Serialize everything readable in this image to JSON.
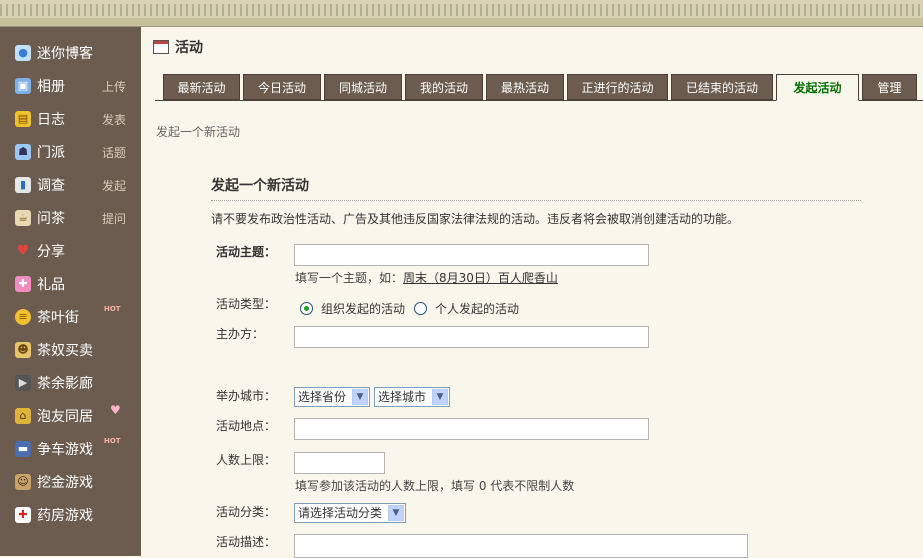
{
  "sidebar": {
    "items": [
      {
        "label": "迷你博客",
        "sub": "",
        "icon": "speech-bubble-icon"
      },
      {
        "label": "相册",
        "sub": "上传",
        "icon": "photo-icon"
      },
      {
        "label": "日志",
        "sub": "发表",
        "icon": "notebook-icon"
      },
      {
        "label": "门派",
        "sub": "话题",
        "icon": "group-icon"
      },
      {
        "label": "调查",
        "sub": "发起",
        "icon": "bar-chart-icon"
      },
      {
        "label": "问茶",
        "sub": "提问",
        "icon": "tea-cup-icon"
      },
      {
        "label": "分享",
        "sub": "",
        "icon": "heart-share-icon"
      },
      {
        "label": "礼品",
        "sub": "",
        "icon": "gift-icon"
      },
      {
        "label": "茶叶街",
        "sub": "",
        "icon": "coins-icon",
        "badge": "HOT"
      },
      {
        "label": "茶奴买卖",
        "sub": "",
        "icon": "trade-icon"
      },
      {
        "label": "茶余影廊",
        "sub": "",
        "icon": "film-icon"
      },
      {
        "label": "泡友同居",
        "sub": "",
        "icon": "house-icon",
        "heart": "♥"
      },
      {
        "label": "争车游戏",
        "sub": "",
        "icon": "car-icon",
        "badge": "HOT"
      },
      {
        "label": "挖金游戏",
        "sub": "",
        "icon": "miner-icon"
      },
      {
        "label": "药房游戏",
        "sub": "",
        "icon": "medicine-icon"
      }
    ]
  },
  "page": {
    "title": "活动"
  },
  "tabs": [
    "最新活动",
    "今日活动",
    "同城活动",
    "我的活动",
    "最热活动",
    "正进行的活动",
    "已结束的活动",
    "发起活动",
    "管理"
  ],
  "active_tab": "发起活动",
  "breadcrumb": "发起一个新活动",
  "form": {
    "title": "发起一个新活动",
    "notice": "请不要发布政治性活动、广告及其他违反国家法律法规的活动。违反者将会被取消创建活动的功能。",
    "subject_label": "活动主题：",
    "subject_hint_prefix": "填写一个主题，如：",
    "subject_hint_example": "周末（8月30日）百人爬香山",
    "type_label": "活动类型：",
    "type_option_org": "组织发起的活动",
    "type_option_personal": "个人发起的活动",
    "organizer_label": "主办方：",
    "city_label": "举办城市：",
    "province_select": "选择省份",
    "city_select": "选择城市",
    "location_label": "活动地点：",
    "limit_label": "人数上限：",
    "limit_hint": "填写参加该活动的人数上限，填写 0 代表不限制人数",
    "category_label": "活动分类：",
    "category_select": "请选择活动分类",
    "desc_label": "活动描述："
  }
}
